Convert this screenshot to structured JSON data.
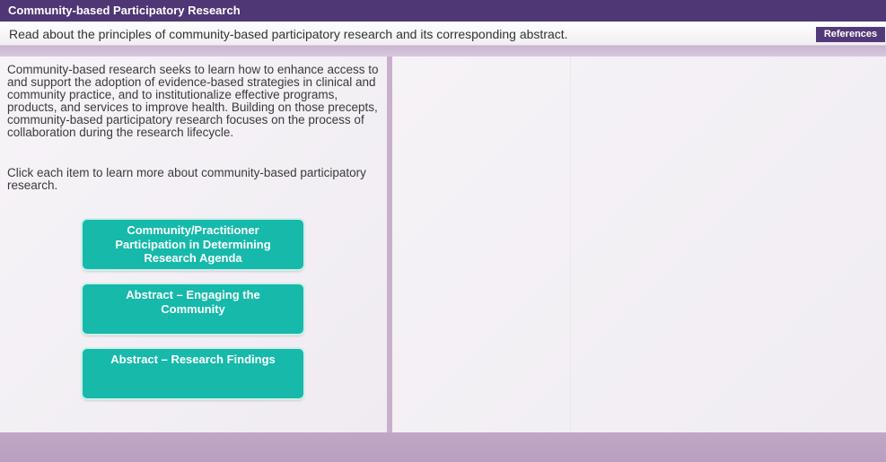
{
  "header": {
    "title": "Community-based Participatory Research",
    "instruction": "Read about the principles of community-based participatory research and its corresponding abstract.",
    "references_label": "References"
  },
  "content": {
    "paragraph1": "Community-based research seeks to learn how to enhance access to and support the adoption of evidence-based strategies in clinical and community practice, and to institutionalize effective programs, products, and services to improve health. Building on those precepts, community-based participatory research focuses on the process of collaboration during the research lifecycle.",
    "paragraph2": "Click each item to learn more about community-based participatory research."
  },
  "buttons": [
    {
      "label": "Community/Practitioner Participation in Determining Research Agenda"
    },
    {
      "label": "Abstract – Engaging the Community"
    },
    {
      "label": "Abstract – Research Findings"
    }
  ],
  "colors": {
    "title_bar": "#4f3776",
    "button": "#16b9aa",
    "references_button": "#54397a"
  }
}
